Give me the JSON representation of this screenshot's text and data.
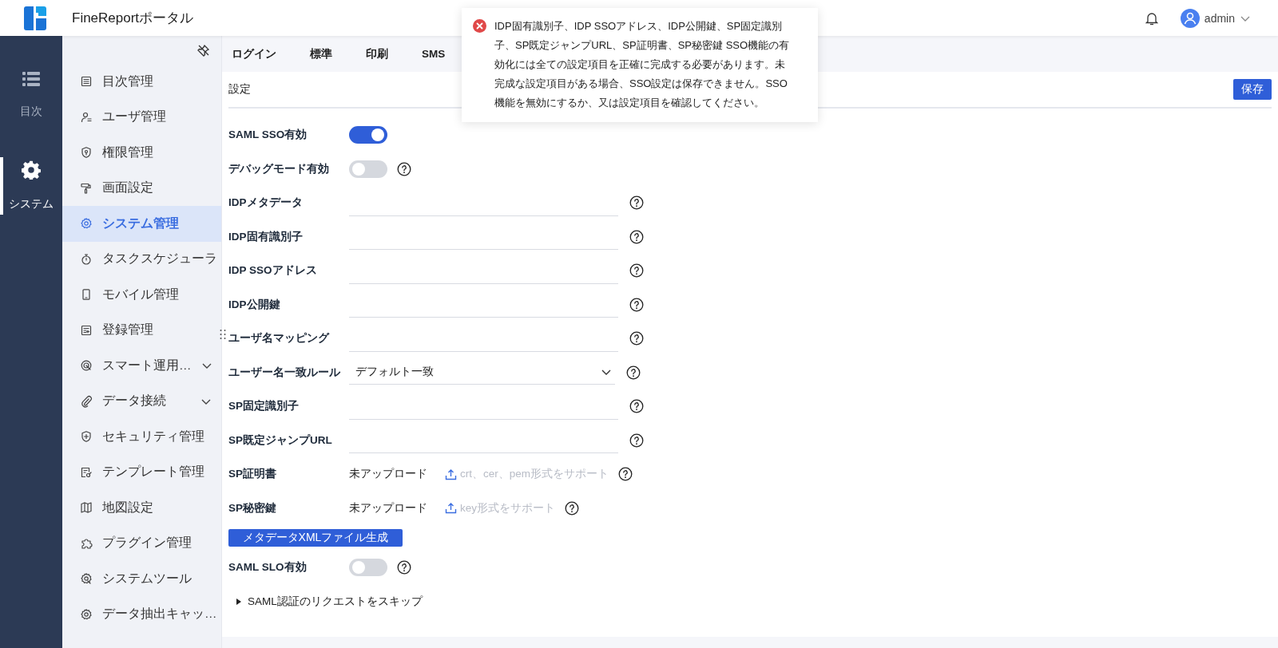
{
  "header": {
    "title": "FineReportポータル",
    "user": "admin"
  },
  "rail": [
    {
      "label": "目次",
      "selected": false
    },
    {
      "label": "システム",
      "selected": true
    }
  ],
  "sidebar": {
    "items": [
      {
        "label": "目次管理",
        "kind": "item",
        "selected": false
      },
      {
        "label": "ユーザ管理",
        "kind": "item",
        "selected": false
      },
      {
        "label": "権限管理",
        "kind": "item",
        "selected": false
      },
      {
        "label": "画面設定",
        "kind": "item",
        "selected": false
      },
      {
        "label": "システム管理",
        "kind": "item",
        "selected": true
      },
      {
        "label": "タスクスケジューラ",
        "kind": "item",
        "selected": false
      },
      {
        "label": "モバイル管理",
        "kind": "item",
        "selected": false
      },
      {
        "label": "登録管理",
        "kind": "item",
        "selected": false
      },
      {
        "label": "スマート運用…",
        "kind": "group",
        "selected": false,
        "expanded": false
      },
      {
        "label": "データ接続",
        "kind": "group",
        "selected": false,
        "expanded": false
      },
      {
        "label": "セキュリティ管理",
        "kind": "item",
        "selected": false
      },
      {
        "label": "テンプレート管理",
        "kind": "item",
        "selected": false
      },
      {
        "label": "地図設定",
        "kind": "item",
        "selected": false
      },
      {
        "label": "プラグイン管理",
        "kind": "item",
        "selected": false
      },
      {
        "label": "システムツール",
        "kind": "item",
        "selected": false
      },
      {
        "label": "データ抽出キャッ…",
        "kind": "item",
        "selected": false
      }
    ]
  },
  "tabs": [
    {
      "label": "ログイン"
    },
    {
      "label": "標準"
    },
    {
      "label": "印刷"
    },
    {
      "label": "SMS"
    }
  ],
  "section": {
    "title": "設定",
    "save": "保存"
  },
  "form": [
    {
      "label": "SAML SSO有効",
      "kind": "toggle",
      "on": true,
      "help": false
    },
    {
      "label": "デバッグモード有効",
      "kind": "toggle",
      "on": false,
      "help": true
    },
    {
      "label": "IDPメタデータ",
      "kind": "text",
      "help": true
    },
    {
      "label": "IDP固有識別子",
      "kind": "text",
      "help": true
    },
    {
      "label": "IDP SSOアドレス",
      "kind": "text",
      "help": true
    },
    {
      "label": "IDP公開鍵",
      "kind": "text",
      "help": true
    },
    {
      "label": "ユーザ名マッピング",
      "kind": "text",
      "help": true
    },
    {
      "label": "ユーザー名一致ルール",
      "kind": "select",
      "value": "デフォルト一致",
      "help": true
    },
    {
      "label": "SP固定識別子",
      "kind": "text",
      "help": true
    },
    {
      "label": "SP既定ジャンプURL",
      "kind": "text",
      "help": true
    },
    {
      "label": "SP証明書",
      "kind": "upload",
      "status": "未アップロード",
      "hint": "crt、cer、pem形式をサポート",
      "help": true
    },
    {
      "label": "SP秘密鍵",
      "kind": "upload",
      "status": "未アップロード",
      "hint": "key形式をサポート",
      "help": true
    },
    {
      "label": "メタデータXMLファイル生成",
      "kind": "button"
    },
    {
      "label": "SAML SLO有効",
      "kind": "toggle",
      "on": false,
      "help": true
    },
    {
      "label": "SAML認証のリクエストをスキップ",
      "kind": "disclosure",
      "expanded": false
    }
  ],
  "toast": {
    "kind": "error",
    "message": "IDP固有識別子、IDP SSOアドレス、IDP公開鍵、SP固定識別子、SP既定ジャンプURL、SP証明書、SP秘密鍵 SSO機能の有効化には全ての設定項目を正確に完成する必要があります。未完成な設定項目がある場合、SSO設定は保存できません。SSO機能を無効にするか、又は設定項目を確認してください。"
  }
}
